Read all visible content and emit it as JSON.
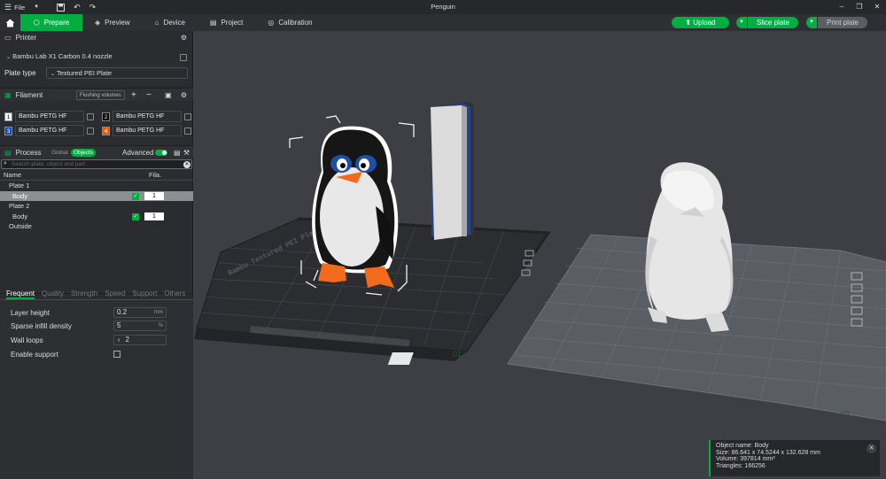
{
  "window": {
    "title": "Penguin",
    "file_menu": "File"
  },
  "nav": {
    "tabs": [
      "Prepare",
      "Preview",
      "Device",
      "Project",
      "Calibration"
    ],
    "active": "Prepare"
  },
  "actions": {
    "upload": "Upload",
    "slice": "Slice plate",
    "print": "Print plate"
  },
  "printer": {
    "section": "Printer",
    "model": "Bambu Lab X1 Carbon 0.4 nozzle",
    "plate_type_label": "Plate type",
    "plate_type": "Textured PEI Plate"
  },
  "filament": {
    "section": "Filament",
    "flushing": "Flushing volumes",
    "slots": [
      {
        "num": "1",
        "name": "Bambu PETG HF",
        "color": "#ffffff"
      },
      {
        "num": "2",
        "name": "Bambu PETG HF",
        "color": "#000000"
      },
      {
        "num": "3",
        "name": "Bambu PETG HF",
        "color": "#1a4fa8"
      },
      {
        "num": "4",
        "name": "Bambu PETG HF",
        "color": "#e85a0c"
      }
    ]
  },
  "process": {
    "section": "Process",
    "global": "Global",
    "objects": "Objects",
    "advanced": "Advanced",
    "search_placeholder": "Search plate, object and part"
  },
  "tree": {
    "col_name": "Name",
    "col_fila": "Fila.",
    "rows": [
      {
        "label": "Plate 1",
        "level": 0
      },
      {
        "label": "Body",
        "level": 1,
        "fila": "1",
        "selected": true
      },
      {
        "label": "Plate 2",
        "level": 0
      },
      {
        "label": "Body",
        "level": 1,
        "fila": "1",
        "selected": false
      },
      {
        "label": "Outside",
        "level": 0
      }
    ]
  },
  "param_tabs": [
    "Frequent",
    "Quality",
    "Strength",
    "Speed",
    "Support",
    "Others"
  ],
  "params": {
    "layer_height_label": "Layer height",
    "layer_height": "0.2",
    "layer_height_unit": "mm",
    "infill_label": "Sparse infill density",
    "infill": "5",
    "infill_unit": "%",
    "walls_label": "Wall loops",
    "walls": "2",
    "support_label": "Enable support"
  },
  "plates": {
    "plate1_number": "01",
    "plate2_number": "02",
    "plate_text": "Bambu Textured PEI Plate"
  },
  "object_info": {
    "name": "Object name: Body",
    "size": "Size: 86.641 x 74.5244 x 132.628 mm",
    "volume": "Volume: 397814 mm³",
    "triangles": "Triangles: 166256"
  },
  "colors": {
    "accent": "#00ae42",
    "panel": "#2a2c30",
    "viewport": "#3d3f44"
  }
}
